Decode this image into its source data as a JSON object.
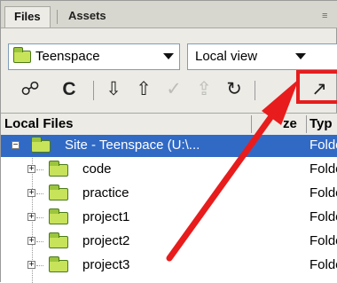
{
  "tabs": {
    "files": "Files",
    "assets": "Assets",
    "grip": "≡"
  },
  "site_select": {
    "value": "Teenspace"
  },
  "view_select": {
    "value": "Local view"
  },
  "toolbar": {
    "connect_icon": "☍",
    "refresh_icon": "C",
    "get_icon": "⇩",
    "put_icon": "⇧",
    "checkout_icon": "✓",
    "checkin_icon": "⇪",
    "sync_icon": "↻",
    "expand_icon": "↗"
  },
  "columns": {
    "local_files": "Local Files",
    "size": "ze",
    "type": "Typ"
  },
  "rows": [
    {
      "name": "Site - Teenspace (U:\\...",
      "type": "Folde",
      "expander": "−"
    },
    {
      "name": "code",
      "type": "Folde",
      "expander": "+"
    },
    {
      "name": "practice",
      "type": "Folde",
      "expander": "+"
    },
    {
      "name": "project1",
      "type": "Folde",
      "expander": "+"
    },
    {
      "name": "project2",
      "type": "Folde",
      "expander": "+"
    },
    {
      "name": "project3",
      "type": "Folde",
      "expander": "+"
    }
  ],
  "colors": {
    "highlight": "#e81c1c",
    "selection": "#316ac5",
    "folder": "#c7e35a"
  }
}
